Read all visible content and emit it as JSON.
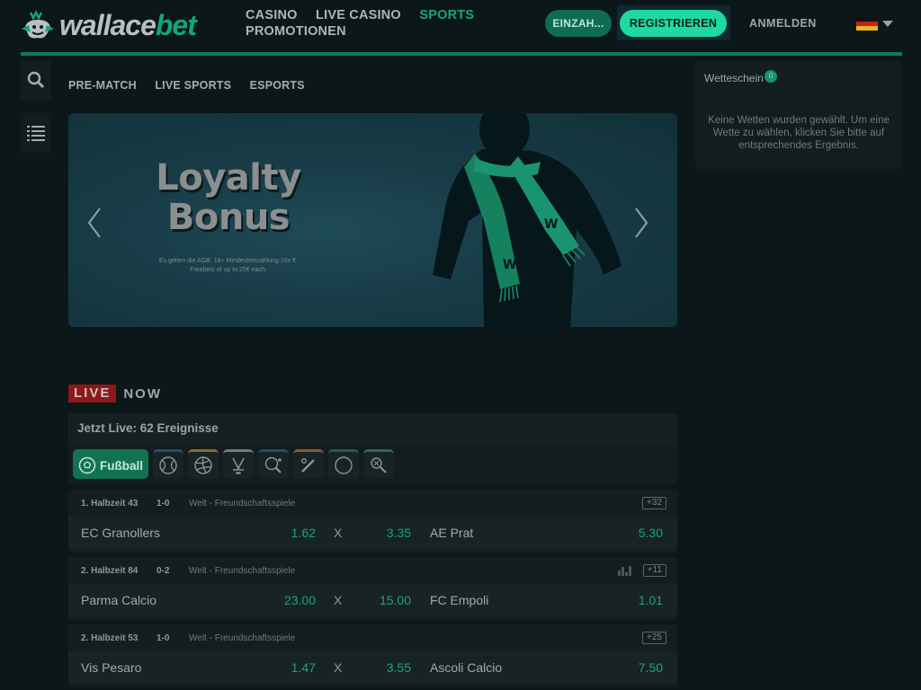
{
  "brand": {
    "logo_part1": "wallace",
    "logo_part2": "bet"
  },
  "nav": {
    "items": [
      {
        "label": "CASINO",
        "active": false
      },
      {
        "label": "LIVE CASINO",
        "active": false
      },
      {
        "label": "SPORTS",
        "active": true
      },
      {
        "label": "PROMOTIONEN",
        "active": false
      }
    ]
  },
  "header": {
    "deposit_label": "EINZAH...",
    "register_label": "REGISTRIEREN",
    "login_label": "ANMELDEN",
    "language_flag": "german-flag-icon"
  },
  "sidebar": {
    "icons": [
      "search-icon",
      "list-icon"
    ]
  },
  "subnav": {
    "items": [
      "PRE-MATCH",
      "LIVE SPORTS",
      "ESPORTS"
    ]
  },
  "banner": {
    "title_line1": "Loyalty",
    "title_line2": "Bonus",
    "terms_line1": "Es gelten die AGB. 18+ Mindesteinzahlung 10x €.",
    "terms_line2": "Freebets of up to 25€ each."
  },
  "live": {
    "badge": "LIVE",
    "suffix": "NOW",
    "header": "Jetzt Live: 62 Ereignisse",
    "active_sport": "Fußball",
    "sport_icons": [
      "football-icon",
      "tennis-icon",
      "volleyball-icon",
      "ice-hockey-icon",
      "table-tennis-icon",
      "baseball-icon",
      "basketball-icon",
      "badminton-icon"
    ]
  },
  "matches": [
    {
      "period": "1. Halbzeit 43",
      "score": "1-0",
      "league": "Welt - Freundschaftsspiele",
      "more": "+32",
      "stats": false,
      "home": "EC Granollers",
      "odd_home": "1.62",
      "x": "X",
      "odd_draw": "3.35",
      "away": "AE Prat",
      "odd_away": "5.30"
    },
    {
      "period": "2. Halbzeit 84",
      "score": "0-2",
      "league": "Welt - Freundschaftsspiele",
      "more": "+11",
      "stats": true,
      "home": "Parma Calcio",
      "odd_home": "23.00",
      "x": "X",
      "odd_draw": "15.00",
      "away": "FC Empoli",
      "odd_away": "1.01"
    },
    {
      "period": "2. Halbzeit 53",
      "score": "1-0",
      "league": "Welt - Freundschaftsspiele",
      "more": "+25",
      "stats": false,
      "home": "Vis Pesaro",
      "odd_home": "1.47",
      "x": "X",
      "odd_draw": "3.55",
      "away": "Ascoli Calcio",
      "odd_away": "7.50"
    }
  ],
  "betslip": {
    "title": "Wetteschein",
    "count": "0",
    "empty_text": "Keine Wetten wurden gewählt. Um eine Wette zu wählen, klicken Sie bitte auf entsprechendes Ergebnis."
  },
  "colors": {
    "background": "#0b1718",
    "accent": "#17a57d",
    "register": "#1fd9a2",
    "live_badge": "#8e1818"
  }
}
